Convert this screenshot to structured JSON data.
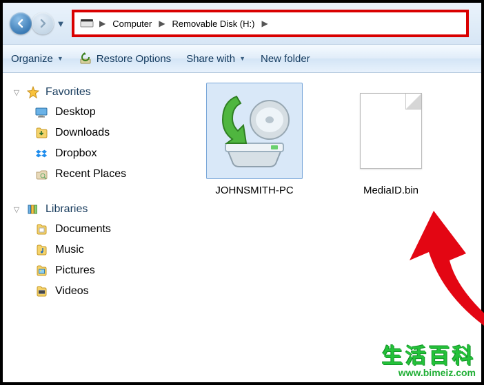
{
  "breadcrumb": {
    "root": "Computer",
    "location": "Removable Disk (H:)"
  },
  "toolbar": {
    "organize": "Organize",
    "restore": "Restore Options",
    "share": "Share with",
    "newfolder": "New folder"
  },
  "sidebar": {
    "favorites_header": "Favorites",
    "favorites": [
      {
        "label": "Desktop"
      },
      {
        "label": "Downloads"
      },
      {
        "label": "Dropbox"
      },
      {
        "label": "Recent Places"
      }
    ],
    "libraries_header": "Libraries",
    "libraries": [
      {
        "label": "Documents"
      },
      {
        "label": "Music"
      },
      {
        "label": "Pictures"
      },
      {
        "label": "Videos"
      }
    ]
  },
  "files": [
    {
      "label": "JOHNSMITH-PC",
      "selected": true
    },
    {
      "label": "MediaID.bin",
      "selected": false
    }
  ],
  "watermark": {
    "cn": "生活百科",
    "url": "www.bimeiz.com"
  }
}
